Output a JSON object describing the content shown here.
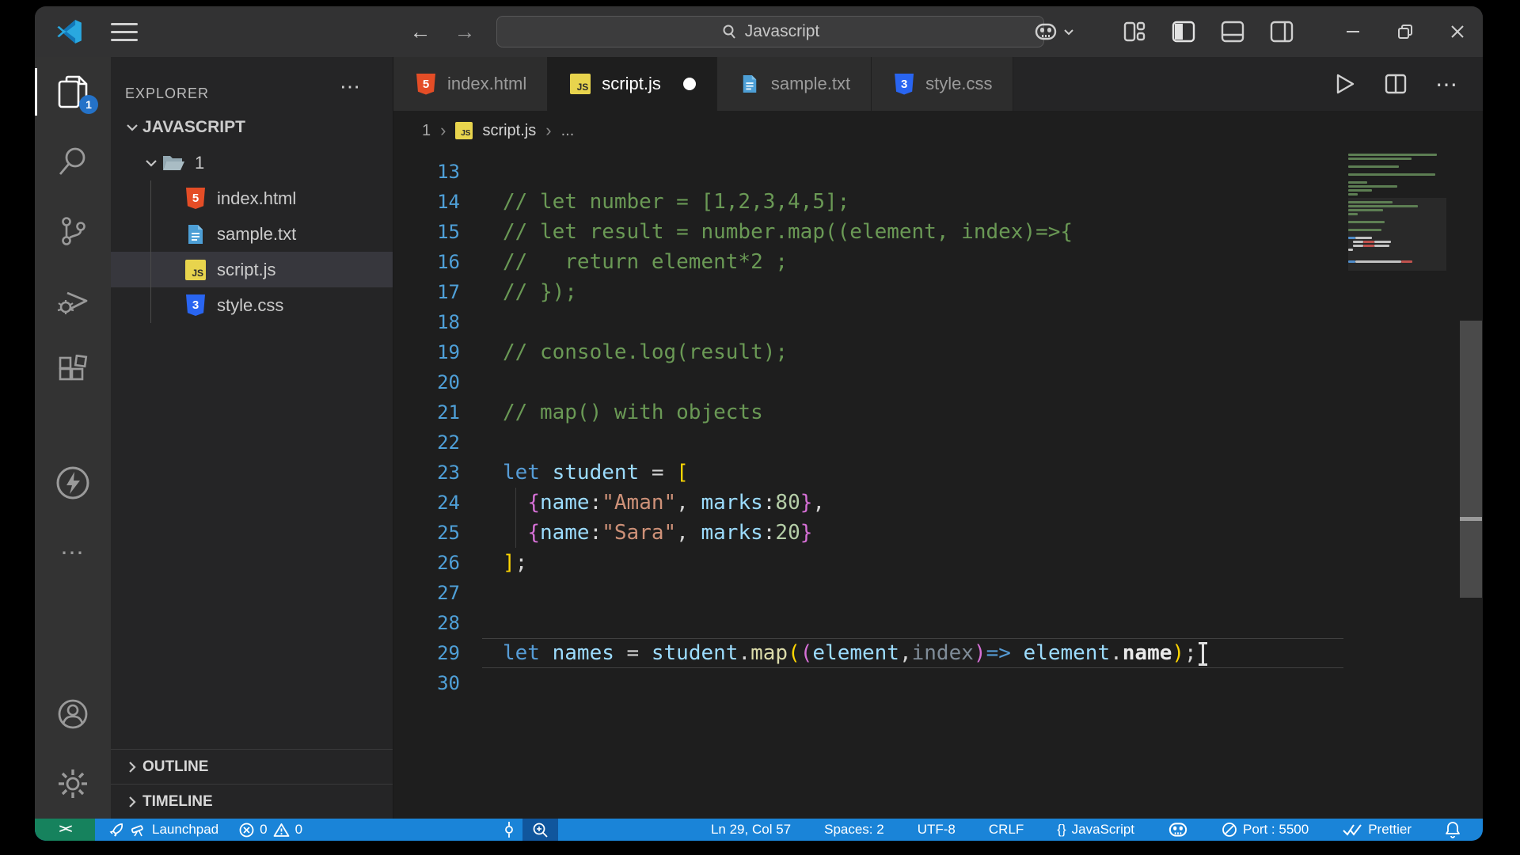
{
  "titlebar": {
    "search_value": "Javascript",
    "menu_icon": "hamburger",
    "back": "←",
    "forward": "→"
  },
  "activity_bar": {
    "explorer_badge": "1",
    "more": "⋯"
  },
  "explorer": {
    "header": "EXPLORER",
    "more": "⋯",
    "root": "JAVASCRIPT",
    "folder": "1",
    "files": [
      {
        "name": "index.html",
        "type": "html",
        "html_glyph": "5"
      },
      {
        "name": "sample.txt",
        "type": "txt"
      },
      {
        "name": "script.js",
        "type": "js",
        "js_glyph": "JS"
      },
      {
        "name": "style.css",
        "type": "css",
        "css_glyph": "3"
      }
    ],
    "sections": [
      {
        "label": "OUTLINE"
      },
      {
        "label": "TIMELINE"
      }
    ]
  },
  "tabs": [
    {
      "label": "index.html",
      "modified": false
    },
    {
      "label": "script.js",
      "modified": true
    },
    {
      "label": "sample.txt",
      "modified": false
    },
    {
      "label": "style.css",
      "modified": false
    }
  ],
  "tab_actions": {
    "more": "⋯"
  },
  "breadcrumb": {
    "folder": "1",
    "file": "script.js",
    "more": "...",
    "sep": "›",
    "js_glyph": "JS"
  },
  "editor": {
    "language": "javascript",
    "lines": [
      {
        "n": 13,
        "segs": []
      },
      {
        "n": 14,
        "segs": [
          [
            "c",
            "// let number = [1,2,3,4,5];"
          ]
        ]
      },
      {
        "n": 15,
        "segs": [
          [
            "c",
            "// let result = number.map((element, index)=>{"
          ]
        ]
      },
      {
        "n": 16,
        "segs": [
          [
            "c",
            "//   return element*2 ;"
          ]
        ]
      },
      {
        "n": 17,
        "segs": [
          [
            "c",
            "// });"
          ]
        ]
      },
      {
        "n": 18,
        "segs": []
      },
      {
        "n": 19,
        "segs": [
          [
            "c",
            "// console.log(result);"
          ]
        ]
      },
      {
        "n": 20,
        "segs": []
      },
      {
        "n": 21,
        "segs": [
          [
            "c",
            "// map() with objects"
          ]
        ]
      },
      {
        "n": 22,
        "segs": []
      },
      {
        "n": 23,
        "segs": [
          [
            "k",
            "let"
          ],
          [
            "o",
            " "
          ],
          [
            "v",
            "student"
          ],
          [
            "o",
            " = "
          ],
          [
            "b1",
            "["
          ]
        ]
      },
      {
        "n": 24,
        "segs": [
          [
            "o",
            "  "
          ],
          [
            "b2",
            "{"
          ],
          [
            "v",
            "name"
          ],
          [
            "o",
            ":"
          ],
          [
            "s",
            "\"Aman\""
          ],
          [
            "o",
            ", "
          ],
          [
            "v",
            "marks"
          ],
          [
            "o",
            ":"
          ],
          [
            "n",
            "80"
          ],
          [
            "b2",
            "}"
          ],
          [
            "o",
            ","
          ]
        ]
      },
      {
        "n": 25,
        "segs": [
          [
            "o",
            "  "
          ],
          [
            "b2",
            "{"
          ],
          [
            "v",
            "name"
          ],
          [
            "o",
            ":"
          ],
          [
            "s",
            "\"Sara\""
          ],
          [
            "o",
            ", "
          ],
          [
            "v",
            "marks"
          ],
          [
            "o",
            ":"
          ],
          [
            "n",
            "20"
          ],
          [
            "b2",
            "}"
          ]
        ]
      },
      {
        "n": 26,
        "segs": [
          [
            "b1",
            "]"
          ],
          [
            "o",
            ";"
          ]
        ]
      },
      {
        "n": 27,
        "segs": []
      },
      {
        "n": 28,
        "segs": []
      },
      {
        "n": 29,
        "current": true,
        "cursor": true,
        "segs": [
          [
            "k",
            "let"
          ],
          [
            "o",
            " "
          ],
          [
            "v",
            "names"
          ],
          [
            "o",
            " = "
          ],
          [
            "v",
            "student"
          ],
          [
            "o",
            "."
          ],
          [
            "f",
            "map"
          ],
          [
            "b1",
            "("
          ],
          [
            "b2",
            "("
          ],
          [
            "v",
            "element"
          ],
          [
            "o",
            ","
          ],
          [
            "dim",
            "index"
          ],
          [
            "b2",
            ")"
          ],
          [
            "k",
            "=>"
          ],
          [
            "o",
            " "
          ],
          [
            "v",
            "element"
          ],
          [
            "o",
            "."
          ],
          [
            "p",
            "name"
          ],
          [
            "b1",
            ")"
          ],
          [
            "o",
            ";"
          ]
        ]
      },
      {
        "n": 30,
        "segs": []
      }
    ]
  },
  "minimap": {
    "rows": [
      [
        [
          "g",
          112
        ]
      ],
      [
        [
          "g",
          80
        ]
      ],
      [],
      [
        [
          "g",
          64
        ]
      ],
      [],
      [
        [
          "g",
          110
        ]
      ],
      [],
      [
        [
          "g",
          24
        ]
      ],
      [
        [
          "g",
          62
        ]
      ],
      [
        [
          "g",
          30
        ]
      ],
      [
        [
          "g",
          12
        ]
      ],
      [],
      [
        [
          "g",
          56
        ]
      ],
      [
        [
          "g",
          88
        ]
      ],
      [
        [
          "g",
          44
        ]
      ],
      [
        [
          "g",
          12
        ]
      ],
      [],
      [
        [
          "g",
          46
        ]
      ],
      [],
      [
        [
          "g",
          42
        ]
      ],
      [],
      [
        [
          "b",
          9
        ],
        [
          "w",
          21
        ]
      ],
      [
        [
          "t",
          6
        ],
        [
          "w",
          13
        ],
        [
          "r",
          14
        ],
        [
          "w",
          21
        ]
      ],
      [
        [
          "t",
          6
        ],
        [
          "w",
          13
        ],
        [
          "r",
          14
        ],
        [
          "w",
          19
        ]
      ],
      [
        [
          "w",
          6
        ]
      ],
      [],
      [],
      [
        [
          "b",
          9
        ],
        [
          "w",
          58
        ],
        [
          "r",
          14
        ]
      ]
    ]
  },
  "status_bar": {
    "remote": "><",
    "launchpad": "Launchpad",
    "errors": "0",
    "warnings": "0",
    "line_col": "Ln 29, Col 57",
    "spaces": "Spaces: 2",
    "encoding": "UTF-8",
    "eol": "CRLF",
    "language_braces": "{}",
    "language": "JavaScript",
    "port": "Port : 5500",
    "prettier": "Prettier"
  },
  "colors": {
    "status_blue": "#1a84d8",
    "remote_green": "#16825d",
    "zoom_cell_blue": "#10569d",
    "badge_blue": "#2472c8",
    "line_number_blue": "#4fa0d8",
    "comment_green": "#6a9955",
    "keyword_blue": "#569cd6",
    "variable_blue": "#9cdcfe",
    "string_orange": "#ce9178",
    "number_green": "#b5cea8",
    "bracket_gold": "#ffd602",
    "bracket_pink": "#d670d6"
  }
}
